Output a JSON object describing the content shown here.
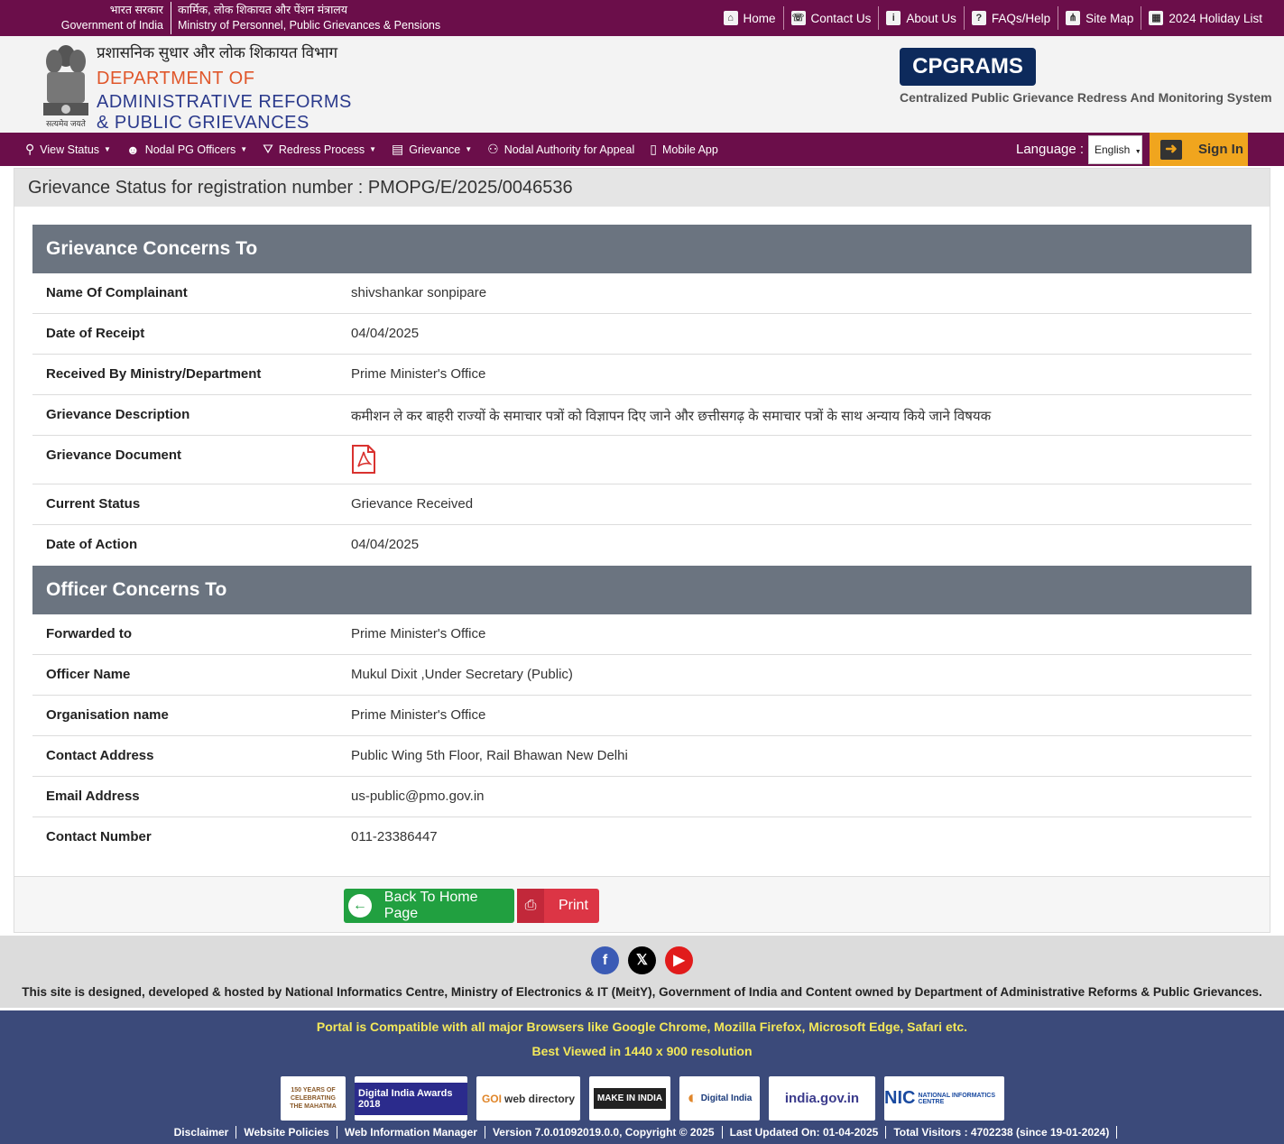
{
  "topbar": {
    "gov_hi": "भारत सरकार",
    "gov_en": "Government of India",
    "ministry_hi": "कार्मिक, लोक शिकायत और पेंशन मंत्रालय",
    "ministry_en": "Ministry of Personnel, Public Grievances & Pensions",
    "links": [
      {
        "label": "Home",
        "icon": "home-icon"
      },
      {
        "label": "Contact Us",
        "icon": "phone-icon"
      },
      {
        "label": "About Us",
        "icon": "info-icon"
      },
      {
        "label": "FAQs/Help",
        "icon": "question-icon"
      },
      {
        "label": "Site Map",
        "icon": "sitemap-icon"
      },
      {
        "label": "2024 Holiday List",
        "icon": "calendar-icon"
      }
    ]
  },
  "header": {
    "dept_hi": "प्रशासनिक सुधार और लोक शिकायत विभाग",
    "dept_line1": "DEPARTMENT OF",
    "dept_line2": "ADMINISTRATIVE REFORMS",
    "dept_line3": "& PUBLIC GRIEVANCES",
    "emblem_motto": "सत्यमेव जयते",
    "badge": "CPGRAMS",
    "badge_sub": "Centralized Public Grievance Redress And Monitoring System"
  },
  "nav": {
    "items": [
      {
        "label": "View Status",
        "icon": "search-icon",
        "dropdown": true
      },
      {
        "label": "Nodal PG Officers",
        "icon": "officer-icon",
        "dropdown": true
      },
      {
        "label": "Redress Process",
        "icon": "road-icon",
        "dropdown": true
      },
      {
        "label": "Grievance",
        "icon": "clipboard-icon",
        "dropdown": true
      },
      {
        "label": "Nodal Authority for Appeal",
        "icon": "users-icon",
        "dropdown": false
      },
      {
        "label": "Mobile App",
        "icon": "mobile-icon",
        "dropdown": false
      }
    ],
    "language_label": "Language :",
    "language_value": "English",
    "signin_label": "Sign In"
  },
  "main": {
    "title": "Grievance Status for registration number : PMOPG/E/2025/0046536",
    "grievance_section": "Grievance Concerns To",
    "grievance_rows": [
      {
        "label": "Name Of Complainant",
        "value": "shivshankar sonpipare"
      },
      {
        "label": "Date of Receipt",
        "value": "04/04/2025"
      },
      {
        "label": "Received By Ministry/Department",
        "value": "Prime Minister's Office"
      },
      {
        "label": "Grievance Description",
        "value": "कमीशन ले कर बाहरी राज्यों के समाचार पत्रों को विज्ञापन दिए जाने और छत्तीसगढ़ के समाचार पत्रों के साथ अन्याय किये जाने विषयक"
      },
      {
        "label": "Grievance Document",
        "value": ""
      },
      {
        "label": "Current Status",
        "value": "Grievance Received"
      },
      {
        "label": "Date of Action",
        "value": "04/04/2025"
      }
    ],
    "officer_section": "Officer Concerns To",
    "officer_rows": [
      {
        "label": "Forwarded to",
        "value": "Prime Minister's Office"
      },
      {
        "label": "Officer Name",
        "value": "Mukul Dixit ,Under Secretary (Public)"
      },
      {
        "label": "Organisation name",
        "value": "Prime Minister's Office"
      },
      {
        "label": "Contact Address",
        "value": "Public Wing 5th Floor, Rail Bhawan New Delhi"
      },
      {
        "label": "Email Address",
        "value": "us-public@pmo.gov.in"
      },
      {
        "label": "Contact Number",
        "value": "011-23386447"
      }
    ],
    "back_label": "Back To Home Page",
    "print_label": "Print"
  },
  "footer": {
    "credit": "This site is designed, developed & hosted by National Informatics Centre, Ministry of Electronics & IT (MeitY), Government of India and Content owned by Department of Administrative Reforms & Public Grievances.",
    "compat": "Portal is Compatible with all major Browsers like Google Chrome, Mozilla Firefox, Microsoft Edge, Safari etc.",
    "best_viewed": "Best Viewed in 1440 x 900 resolution",
    "logos": [
      {
        "name": "mahatma-150-logo",
        "text": "150 YEARS OF CELEBRATING THE MAHATMA"
      },
      {
        "name": "digital-india-awards-logo",
        "text": "Digital India Awards 2018"
      },
      {
        "name": "goi-web-directory-logo",
        "text": "web directory"
      },
      {
        "name": "make-in-india-logo",
        "text": "MAKE IN INDIA"
      },
      {
        "name": "digital-india-logo",
        "text": "Digital India"
      },
      {
        "name": "india-gov-logo",
        "text": "india.gov.in"
      },
      {
        "name": "nic-logo",
        "text": "NATIONAL INFORMATICS CENTRE"
      }
    ],
    "links": [
      {
        "label": "Disclaimer"
      },
      {
        "label": "Website Policies"
      },
      {
        "label": "Web Information Manager"
      },
      {
        "label": "Version 7.0.01092019.0.0, Copyright © 2025"
      },
      {
        "label": "Last Updated On: 01-04-2025"
      },
      {
        "label": "Total Visitors : 4702238 (since 19-01-2024)"
      }
    ]
  }
}
